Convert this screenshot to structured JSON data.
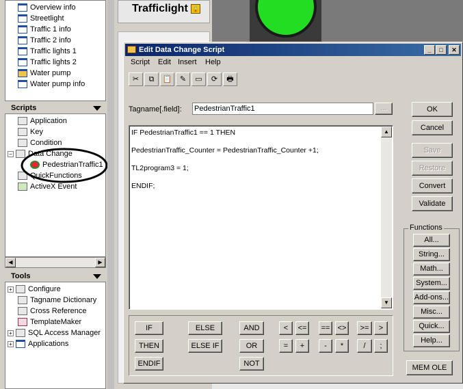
{
  "left_panel": {
    "windows_items": [
      "Overview info",
      "Streetlight",
      "Traffic 1 info",
      "Traffic 2 info",
      "Traffic lights 1",
      "Traffic lights 2",
      "Water pump",
      "Water pump info"
    ],
    "scripts_header": "Scripts",
    "scripts_items": [
      "Application",
      "Key",
      "Condition",
      "Data Change",
      "PedestrianTraffic1",
      "QuickFunctions",
      "ActiveX Event"
    ],
    "tools_header": "Tools",
    "tools_items": [
      "Configure",
      "Tagname Dictionary",
      "Cross Reference",
      "TemplateMaker",
      "SQL Access Manager",
      "Applications"
    ]
  },
  "canvas": {
    "traffic_title": "Trafficlight",
    "light_color": "#22dd22"
  },
  "dialog": {
    "title": "Edit Data Change Script",
    "menu": [
      "Script",
      "Edit",
      "Insert",
      "Help"
    ],
    "tagname_label": "Tagname[.field]:",
    "tagname_value": "PedestrianTraffic1",
    "browse_label": "...",
    "code_lines": [
      "IF PedestrianTraffic1 == 1  THEN",
      "PedestrianTraffic_Counter = PedestrianTraffic_Counter +1;",
      "TL2program3 = 1;",
      "ENDIF;"
    ],
    "buttons": {
      "ok": "OK",
      "cancel": "Cancel",
      "save": "Save",
      "restore": "Restore",
      "convert": "Convert",
      "validate": "Validate",
      "mem_ole": "MEM OLE"
    },
    "functions_label": "Functions",
    "function_buttons": [
      "All...",
      "String...",
      "Math...",
      "System...",
      "Add-ons...",
      "Misc...",
      "Quick...",
      "Help..."
    ],
    "keywords": [
      "IF",
      "THEN",
      "ENDIF",
      "ELSE",
      "ELSE IF",
      "AND",
      "OR",
      "NOT"
    ],
    "operators": [
      "<",
      "<=",
      "==",
      "<>",
      ">=",
      ">",
      "=",
      "+",
      "-",
      "*",
      "/",
      ";"
    ]
  }
}
